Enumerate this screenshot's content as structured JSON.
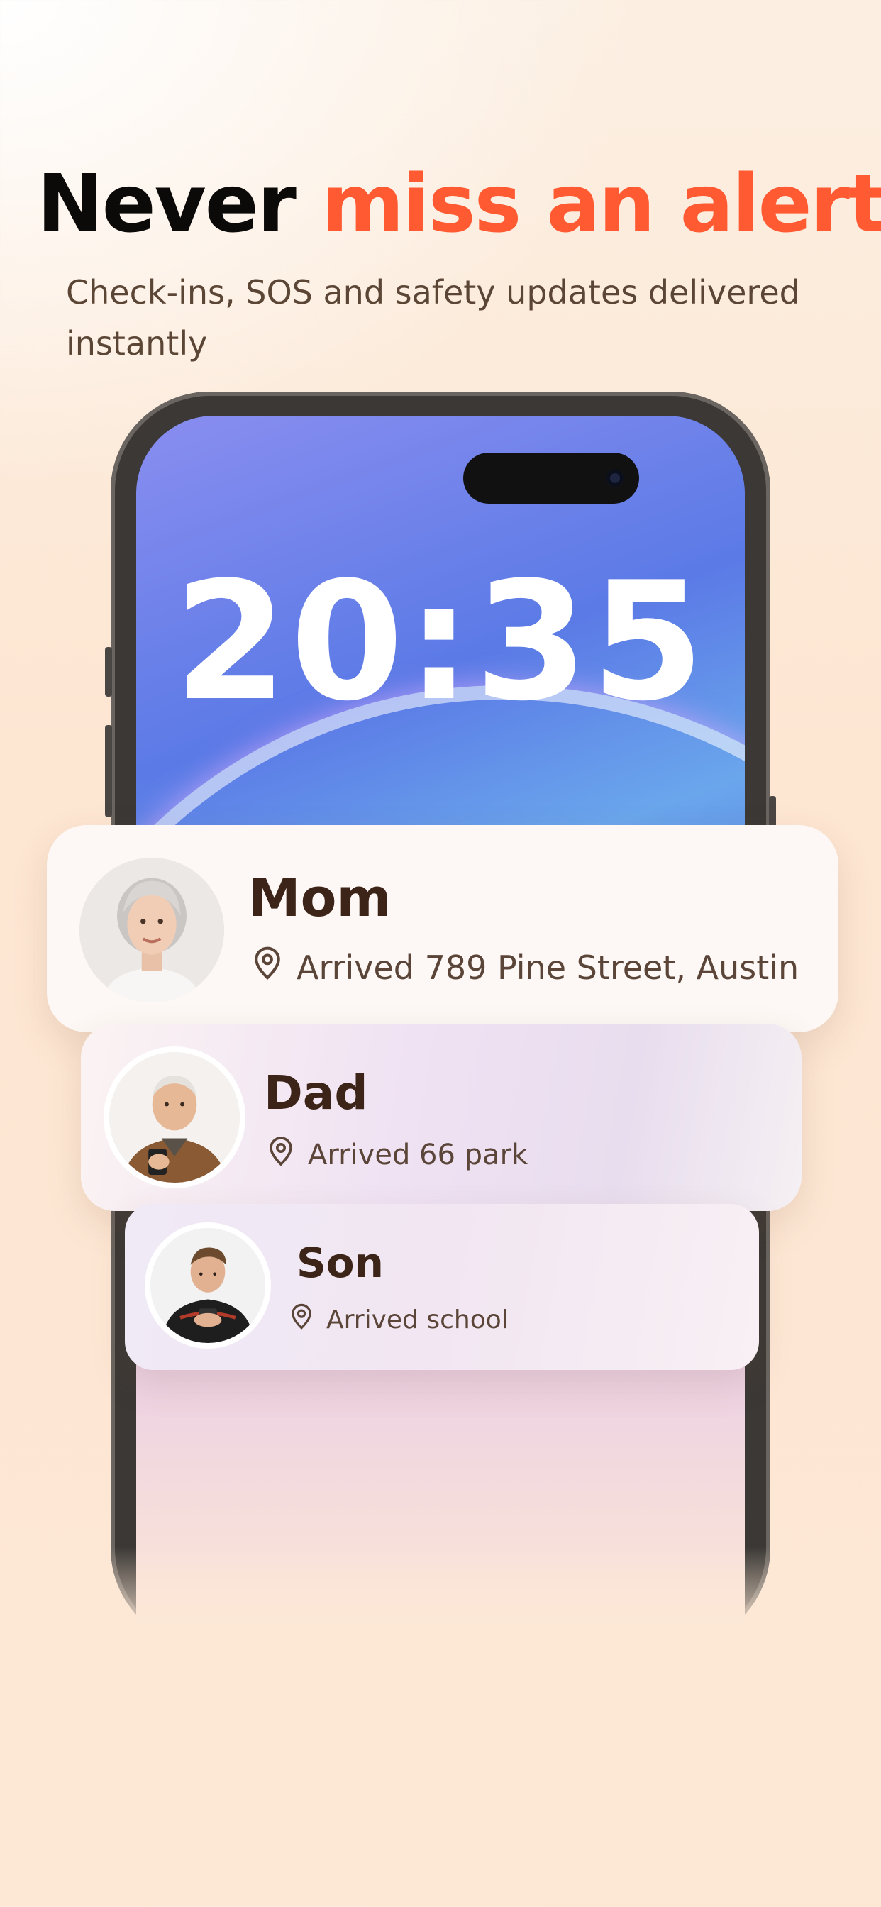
{
  "headline": {
    "part1": "Never",
    "part2": "miss an alert"
  },
  "subtitle": "Check-ins, SOS and safety updates delivered instantly",
  "phone": {
    "clock": "20:35"
  },
  "cards": [
    {
      "name": "Mom",
      "status": "Arrived 789 Pine Street, Austin",
      "icon": "location-pin-icon"
    },
    {
      "name": "Dad",
      "status": "Arrived 66 park",
      "icon": "location-pin-icon"
    },
    {
      "name": "Son",
      "status": "Arrived school",
      "icon": "location-pin-icon"
    }
  ],
  "colors": {
    "accent": "#ff5a32",
    "text_dark": "#0c0a08",
    "name_text": "#3d2418"
  }
}
